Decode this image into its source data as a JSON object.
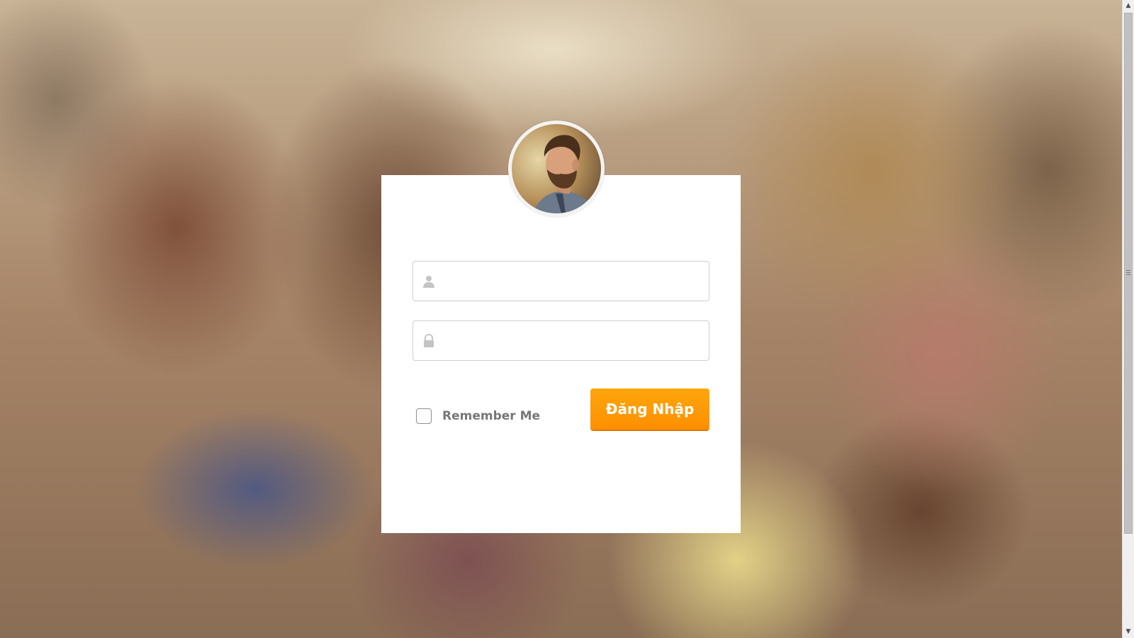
{
  "login": {
    "username": {
      "value": "",
      "placeholder": "",
      "icon": "user-icon"
    },
    "password": {
      "value": "",
      "placeholder": "",
      "icon": "lock-icon"
    },
    "remember_label": "Remember Me",
    "remember_checked": false,
    "submit_label": "Đăng Nhập"
  },
  "avatar": {
    "icon": "user-avatar"
  },
  "colors": {
    "button": "#ff9800",
    "card": "#ffffff",
    "field_border": "#cfcfcf",
    "label": "#777777"
  }
}
